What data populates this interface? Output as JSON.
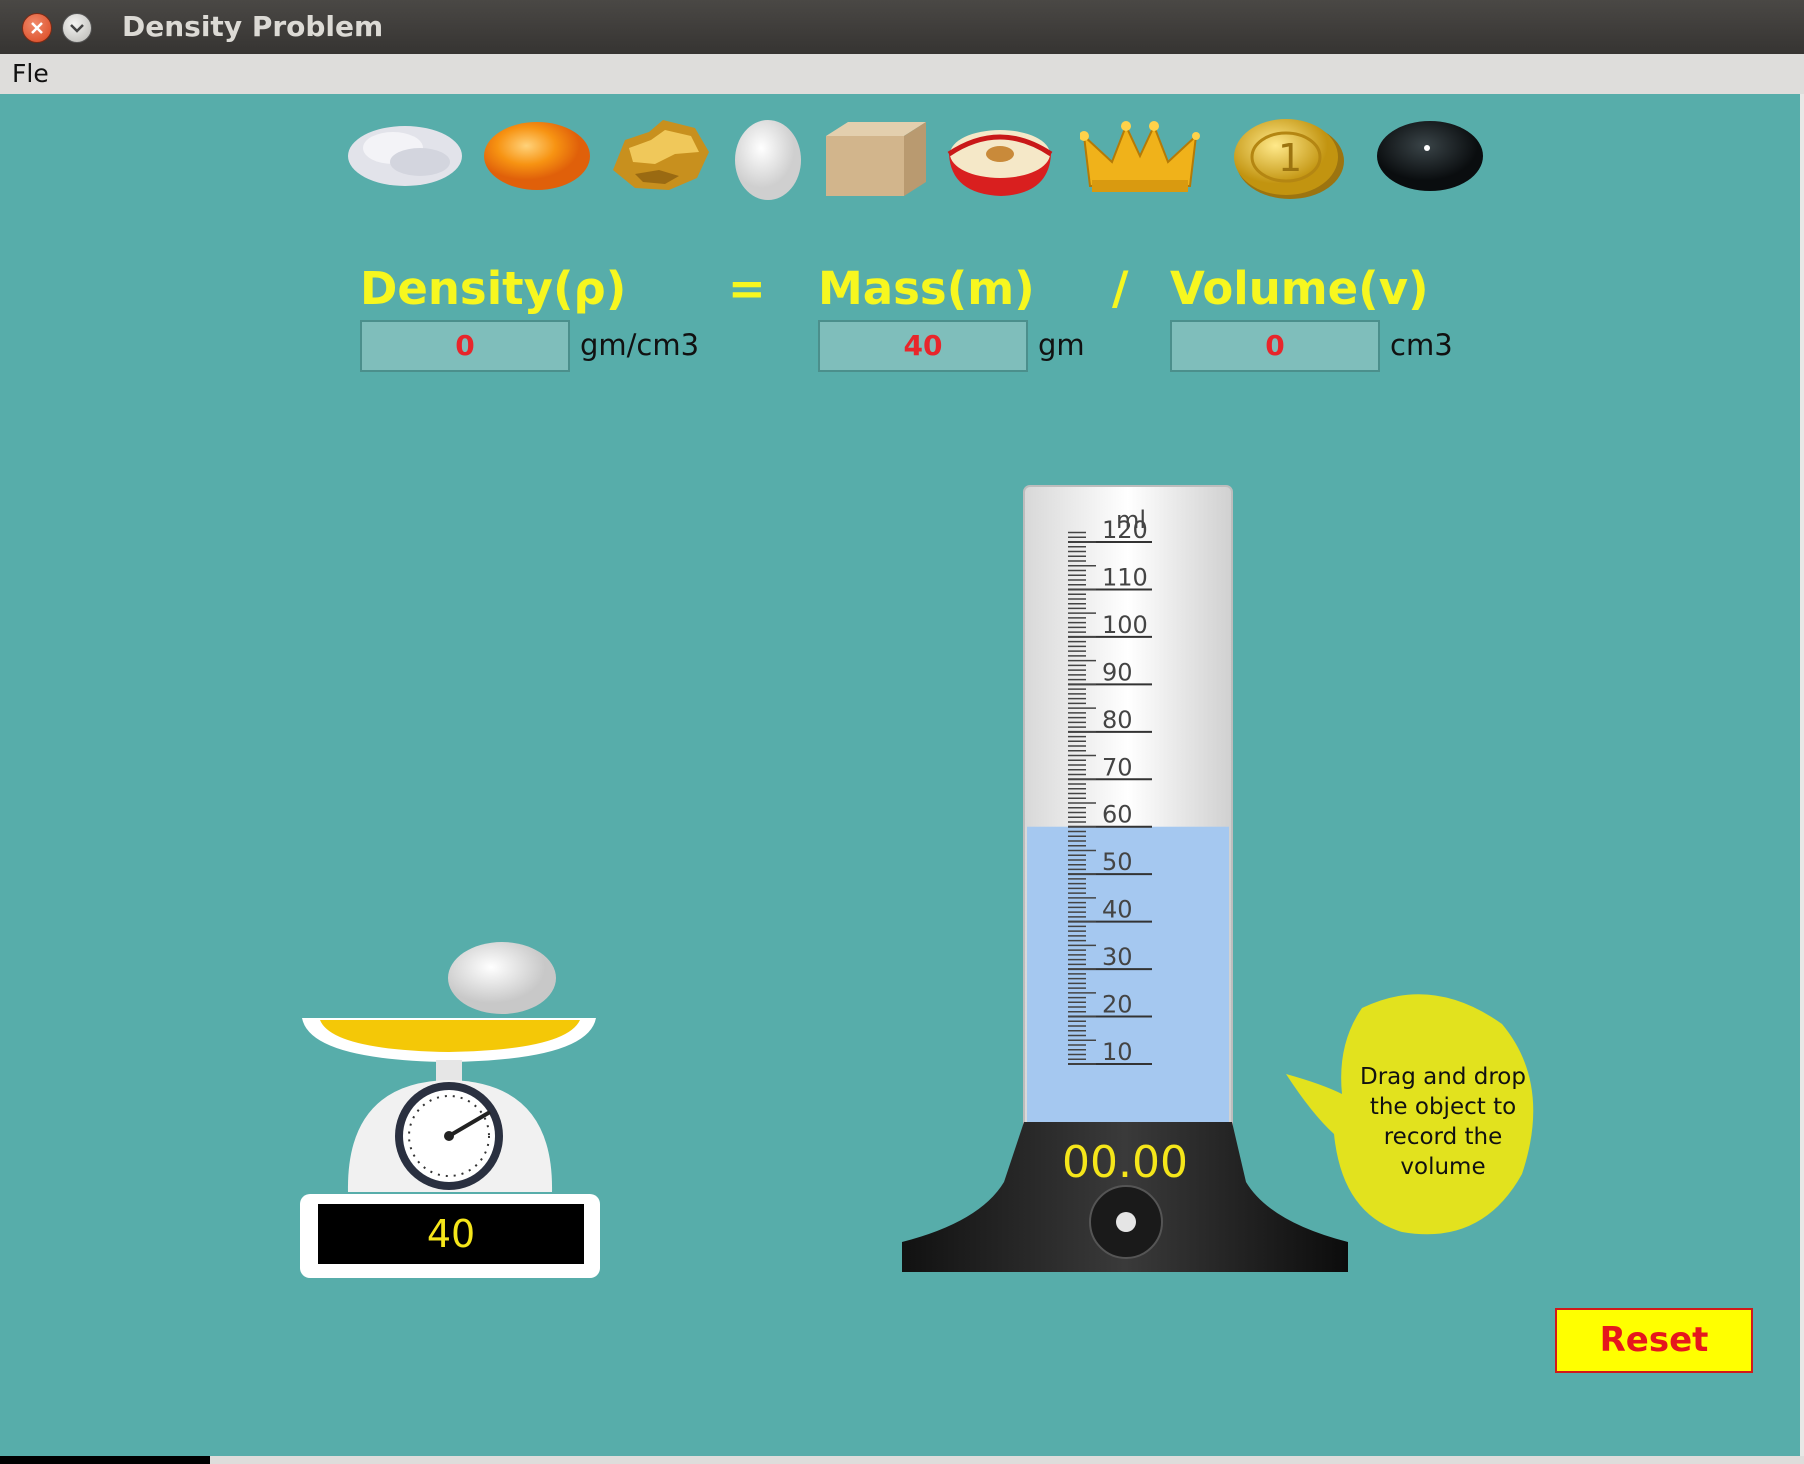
{
  "window": {
    "title": "Density Problem"
  },
  "menu": {
    "file_label": "Fle"
  },
  "objects": [
    {
      "name": "cotton"
    },
    {
      "name": "orange"
    },
    {
      "name": "gold-nugget"
    },
    {
      "name": "egg"
    },
    {
      "name": "wood-block"
    },
    {
      "name": "apple"
    },
    {
      "name": "crown"
    },
    {
      "name": "coin"
    },
    {
      "name": "black-stone"
    }
  ],
  "formula": {
    "density_label": "Density(ρ)",
    "equals": "=",
    "mass_label": "Mass(m)",
    "divide": "/",
    "volume_label": "Volume(v)",
    "density_value": "0",
    "density_unit": "gm/cm3",
    "mass_value": "40",
    "mass_unit": "gm",
    "volume_value": "0",
    "volume_unit": "cm3"
  },
  "scale": {
    "reading": "40",
    "object_on_pan": "golf-ball"
  },
  "cylinder": {
    "unit_label": "ml",
    "ticks": [
      "120",
      "110",
      "100",
      "90",
      "80",
      "70",
      "60",
      "50",
      "40",
      "30",
      "20",
      "10"
    ],
    "water_level_ml": 60,
    "reading": "00.00"
  },
  "hint": {
    "text_lines": [
      "Drag and drop",
      "the object to",
      "record the",
      "volume"
    ]
  },
  "reset": {
    "label": "Reset"
  },
  "colors": {
    "background": "#57adaa",
    "formula_label": "#f7f71f",
    "value_text": "#e8262b",
    "reset_bg": "#ffff00",
    "reset_text": "#e5171d",
    "display_text": "#f5e61a",
    "water": "#a5c8f0"
  }
}
